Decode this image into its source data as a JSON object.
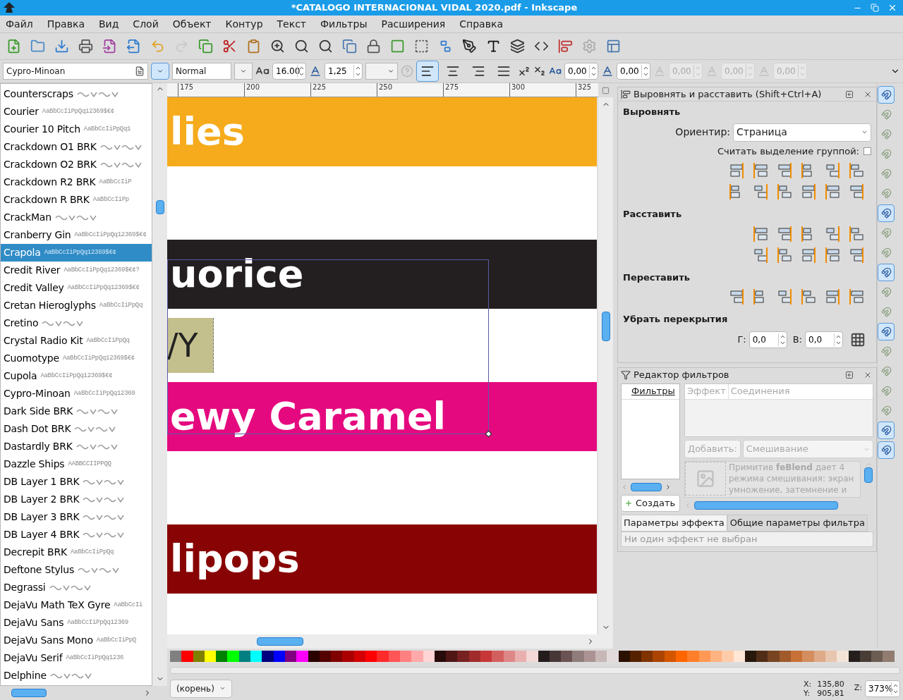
{
  "window": {
    "title": "*CATALOGO INTERNACIONAL VIDAL 2020.pdf - Inkscape"
  },
  "menu": [
    "Файл",
    "Правка",
    "Вид",
    "Слой",
    "Объект",
    "Контур",
    "Текст",
    "Фильтры",
    "Расширения",
    "Справка"
  ],
  "text_toolbar": {
    "font_family": "Cypro-Minoan",
    "font_style": "Normal",
    "font_size": "16.00",
    "line_spacing": "1,25",
    "letter_spacing": "0,00",
    "word_spacing": "0,00",
    "disabled_fields": [
      "0,00",
      "0,00",
      "0,00"
    ],
    "alignments": [
      {
        "selected": true
      },
      {
        "selected": false
      },
      {
        "selected": false
      },
      {
        "selected": false
      }
    ]
  },
  "font_list": [
    {
      "name": "Counterscraps",
      "kind": "glyphs",
      "selected": false
    },
    {
      "name": "Courier",
      "kind": "sample",
      "sample": "AaBbCcIiPpQq12369$€¢",
      "selected": false
    },
    {
      "name": "Courier 10 Pitch",
      "kind": "sample",
      "sample": "AaBbCcIiPpQq1",
      "selected": false
    },
    {
      "name": "Crackdown O1 BRK",
      "kind": "glyphs",
      "selected": false
    },
    {
      "name": "Crackdown O2 BRK",
      "kind": "glyphs",
      "selected": false
    },
    {
      "name": "Crackdown R2 BRK",
      "kind": "sample",
      "sample": "AaBbCcIiP",
      "selected": false
    },
    {
      "name": "Crackdown R BRK",
      "kind": "sample",
      "sample": "AaBbCcIiPp",
      "selected": false
    },
    {
      "name": "CrackMan",
      "kind": "glyphs",
      "selected": false
    },
    {
      "name": "Cranberry Gin",
      "kind": "sample",
      "sample": "AaBbCcIiPpQq12369$€¢",
      "selected": false
    },
    {
      "name": "Crapola",
      "kind": "sample",
      "sample": "AaBbCcIiPpQq12369$€¢",
      "selected": true
    },
    {
      "name": "Credit River",
      "kind": "sample",
      "sample": "AaBbCcIiPpQq12369$€¢?",
      "selected": false
    },
    {
      "name": "Credit Valley",
      "kind": "sample",
      "sample": "AaBbCcIiPpQq12369$€¢",
      "selected": false
    },
    {
      "name": "Cretan Hieroglyphs",
      "kind": "sample",
      "sample": "AaBbCcIiPpQq",
      "selected": false
    },
    {
      "name": "Cretino",
      "kind": "glyphs",
      "selected": false
    },
    {
      "name": "Crystal Radio Kit",
      "kind": "sample",
      "sample": "AaBbCcIiPpQq",
      "selected": false
    },
    {
      "name": "Cuomotype",
      "kind": "sample",
      "sample": "AaBbCcIiPpQq12369$€¢",
      "selected": false
    },
    {
      "name": "Cupola",
      "kind": "sample",
      "sample": "AaBbCcIiPpQq12369$€¢",
      "selected": false
    },
    {
      "name": "Cypro-Minoan",
      "kind": "sample",
      "sample": "AaBbCcIiPpQq12369",
      "selected": false
    },
    {
      "name": "Dark Side BRK",
      "kind": "glyphs",
      "selected": false
    },
    {
      "name": "Dash Dot BRK",
      "kind": "glyphs",
      "selected": false
    },
    {
      "name": "Dastardly BRK",
      "kind": "glyphs",
      "selected": false
    },
    {
      "name": "Dazzle Ships",
      "kind": "sample",
      "sample": "AABBCCIIPPQQ",
      "selected": false
    },
    {
      "name": "DB Layer 1 BRK",
      "kind": "glyphs",
      "selected": false
    },
    {
      "name": "DB Layer 2 BRK",
      "kind": "glyphs",
      "selected": false
    },
    {
      "name": "DB Layer 3 BRK",
      "kind": "glyphs",
      "selected": false
    },
    {
      "name": "DB Layer 4 BRK",
      "kind": "glyphs",
      "selected": false
    },
    {
      "name": "Decrepit BRK",
      "kind": "sample",
      "sample": "AaBbCcIiPpQq",
      "selected": false
    },
    {
      "name": "Deftone Stylus",
      "kind": "glyphs",
      "selected": false
    },
    {
      "name": "Degrassi",
      "kind": "glyphs",
      "selected": false
    },
    {
      "name": "DejaVu Math TeX Gyre",
      "kind": "sample",
      "sample": "AaBbCcIi",
      "selected": false
    },
    {
      "name": "DejaVu Sans",
      "kind": "sample",
      "sample": "AaBbCcIiPpQq12369",
      "selected": false
    },
    {
      "name": "DejaVu Sans Mono",
      "kind": "sample",
      "sample": "AaBbCcIiPpQ",
      "selected": false
    },
    {
      "name": "DejaVu Serif",
      "kind": "sample",
      "sample": "AaBbCcIiPpQq1236",
      "selected": false
    },
    {
      "name": "Delphine",
      "kind": "glyphs",
      "selected": false
    }
  ],
  "ruler": [
    "175",
    "200",
    "225",
    "250",
    "275",
    "300",
    "325"
  ],
  "canvas": {
    "bands": [
      {
        "kind": "label",
        "color": "#f6ab1c",
        "text": "lies"
      },
      {
        "kind": "blank"
      },
      {
        "kind": "label",
        "color": "#231f20",
        "text": "uorice"
      },
      {
        "kind": "tag",
        "text": "/Y"
      },
      {
        "kind": "label",
        "color": "#e5097f",
        "text": "ewy Caramel"
      },
      {
        "kind": "blank"
      },
      {
        "kind": "label",
        "color": "#880404",
        "text": "lipops"
      },
      {
        "kind": "blank"
      }
    ]
  },
  "align_panel": {
    "title": "Выровнять и расставить (Shift+Ctrl+A)",
    "align_heading": "Выровнять",
    "relative_label": "Ориентир:",
    "relative_value": "Страница",
    "group_label": "Считать выделение группой:",
    "group_checked": false,
    "distribute_heading": "Расставить",
    "rearrange_heading": "Переставить",
    "overlap_heading": "Убрать перекрытия",
    "h_label": "Г:",
    "h_value": "0,0",
    "v_label": "В:",
    "v_value": "0,0"
  },
  "filter_panel": {
    "title": "Редактор фильтров",
    "filters_header": "Фильтры",
    "effect_header": "Эффект",
    "connections_header": "Соединения",
    "add_button": "Добавить:",
    "add_value": "Смешивание",
    "description": "Примитив **feBlend** дает 4 режима смешивания: экран умножение, затемнение и",
    "create_button": "Создать",
    "tabs": [
      {
        "label": "Параметры эффекта",
        "selected": true
      },
      {
        "label": "Общие параметры фильтра",
        "selected": false
      }
    ],
    "no_effect": "Ни один эффект не выбран"
  },
  "snap_controls": [
    {
      "on": true
    },
    {
      "on": false
    },
    {
      "on": false
    },
    {
      "on": false
    },
    {
      "on": false
    },
    {
      "on": false
    },
    {
      "on": true
    },
    {
      "on": false
    },
    {
      "on": false
    },
    {
      "on": true
    },
    {
      "on": false
    },
    {
      "on": false
    },
    {
      "on": true
    },
    {
      "on": false
    },
    {
      "on": false
    },
    {
      "on": false
    },
    {
      "on": false
    },
    {
      "on": true
    },
    {
      "on": true
    }
  ],
  "palette": [
    {
      "color": "#808080"
    },
    {
      "color": "#ff0000"
    },
    {
      "color": "#808000"
    },
    {
      "color": "#ffff00"
    },
    {
      "color": "#008000"
    },
    {
      "color": "#00ff00"
    },
    {
      "color": "#008080"
    },
    {
      "color": "#00ffff"
    },
    {
      "color": "#000080"
    },
    {
      "color": "#0000ff"
    },
    {
      "color": "#800080"
    },
    {
      "color": "#ff00ff"
    },
    {
      "color": "#2b0000"
    },
    {
      "color": "#550000"
    },
    {
      "color": "#800000"
    },
    {
      "color": "#aa0000"
    },
    {
      "color": "#d40000"
    },
    {
      "color": "#ff0000"
    },
    {
      "color": "#ff2a2a"
    },
    {
      "color": "#ff5555"
    },
    {
      "color": "#ff8080"
    },
    {
      "color": "#ffaaaa"
    },
    {
      "color": "#ffd5d5"
    },
    {
      "color": "#280b0b"
    },
    {
      "color": "#501616"
    },
    {
      "color": "#782121"
    },
    {
      "color": "#a02c2c"
    },
    {
      "color": "#c83737"
    },
    {
      "color": "#d35f5f"
    },
    {
      "color": "#de8787"
    },
    {
      "color": "#e9afaf"
    },
    {
      "color": "#f4d7d7"
    },
    {
      "color": "#241c1c"
    },
    {
      "color": "#483737"
    },
    {
      "color": "#6c5353"
    },
    {
      "color": "#917c7c"
    },
    {
      "color": "#ac9393"
    },
    {
      "color": "#c8b7b7"
    },
    {
      "color": "#e3dbdb"
    },
    {
      "color": "#2b1100"
    },
    {
      "color": "#552200"
    },
    {
      "color": "#803300"
    },
    {
      "color": "#aa4400"
    },
    {
      "color": "#d45500"
    },
    {
      "color": "#ff6600"
    },
    {
      "color": "#ff7f2a"
    },
    {
      "color": "#ff9955"
    },
    {
      "color": "#ffb380"
    },
    {
      "color": "#ffccaa"
    },
    {
      "color": "#ffe6d5"
    },
    {
      "color": "#28170b"
    },
    {
      "color": "#502d16"
    },
    {
      "color": "#784421"
    },
    {
      "color": "#a05a2c"
    },
    {
      "color": "#c87137"
    },
    {
      "color": "#d38d5f"
    },
    {
      "color": "#deaa87"
    },
    {
      "color": "#e9c6af"
    },
    {
      "color": "#f4e3d7"
    },
    {
      "color": "#241f1c"
    },
    {
      "color": "#483e37"
    },
    {
      "color": "#6c5d53"
    },
    {
      "color": "#917c6f"
    }
  ],
  "status_bar": {
    "layer": "(корень)",
    "x_label": "X:",
    "x_value": "135,80",
    "y_label": "Y:",
    "y_value": "905,81",
    "zoom_label": "Z:",
    "zoom_value": "373%"
  }
}
